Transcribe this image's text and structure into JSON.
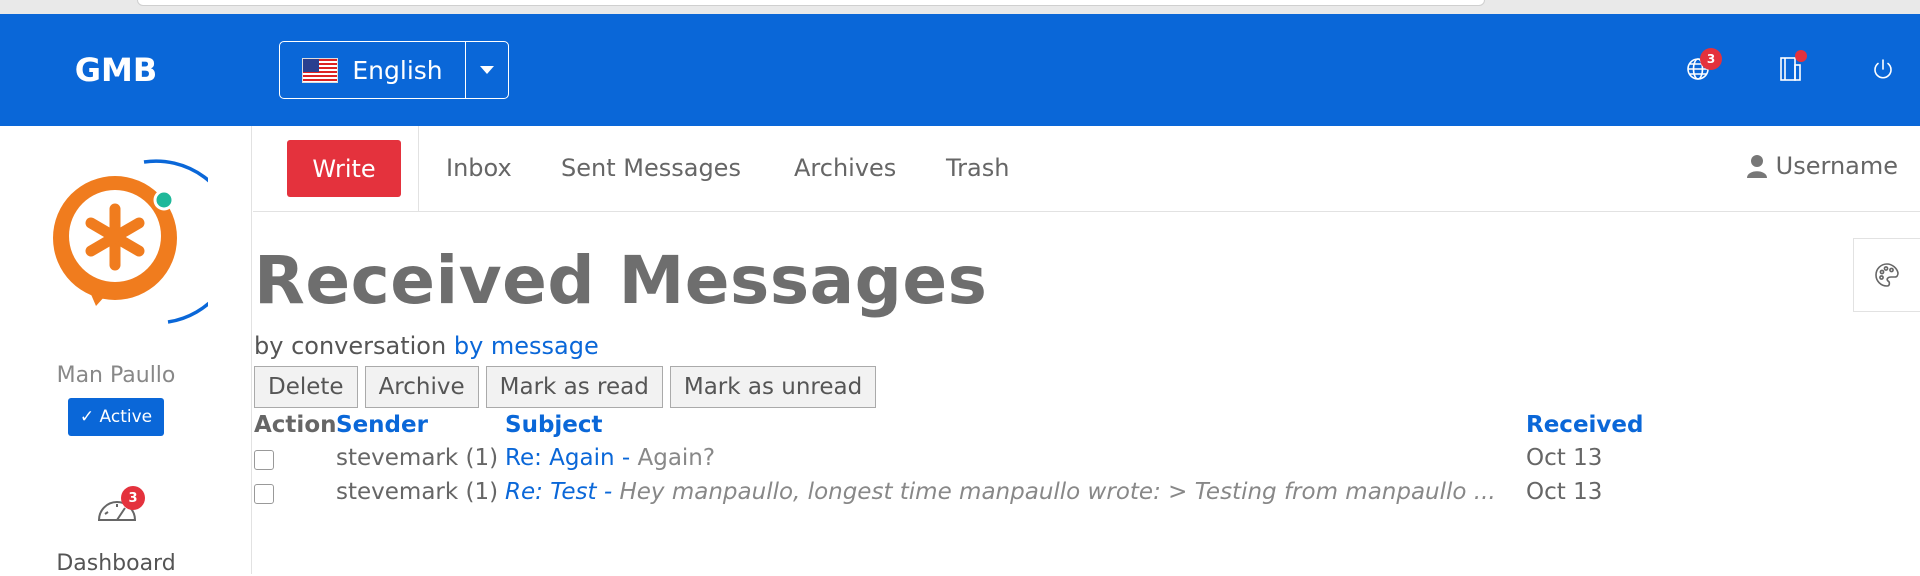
{
  "header": {
    "brand": "GMB",
    "language": "English",
    "globe_badge": "3",
    "icons": [
      "globe-icon",
      "notebook-icon",
      "power-icon"
    ]
  },
  "sidebar": {
    "user_name": "Man Paullo",
    "status": "✓ Active",
    "dashboard_badge": "3",
    "dashboard_label": "Dashboard"
  },
  "tabs": {
    "write": "Write",
    "inbox": "Inbox",
    "sent": "Sent Messages",
    "archives": "Archives",
    "trash": "Trash",
    "username": "Username"
  },
  "main": {
    "title": "Received Messages",
    "view_by_conversation": "by conversation",
    "view_by_message": "by message",
    "buttons": {
      "delete": "Delete",
      "archive": "Archive",
      "mark_read": "Mark as read",
      "mark_unread": "Mark as unread"
    },
    "columns": {
      "action": "Action",
      "sender": "Sender",
      "subject": "Subject",
      "received": "Received"
    },
    "rows": [
      {
        "sender": "stevemark",
        "count": "(1)",
        "subject": "Re: Again",
        "separator": " - ",
        "preview": "Again?",
        "received": "Oct 13"
      },
      {
        "sender": "stevemark",
        "count": "(1)",
        "subject": "Re: Test",
        "separator": " - ",
        "preview": "Hey manpaullo, longest time manpaullo wrote: > Testing from manpaullo ...",
        "received": "Oct 13"
      }
    ]
  },
  "colors": {
    "primary": "#0a67d8",
    "danger": "#e4323d",
    "status_dot": "#1fb89a"
  }
}
